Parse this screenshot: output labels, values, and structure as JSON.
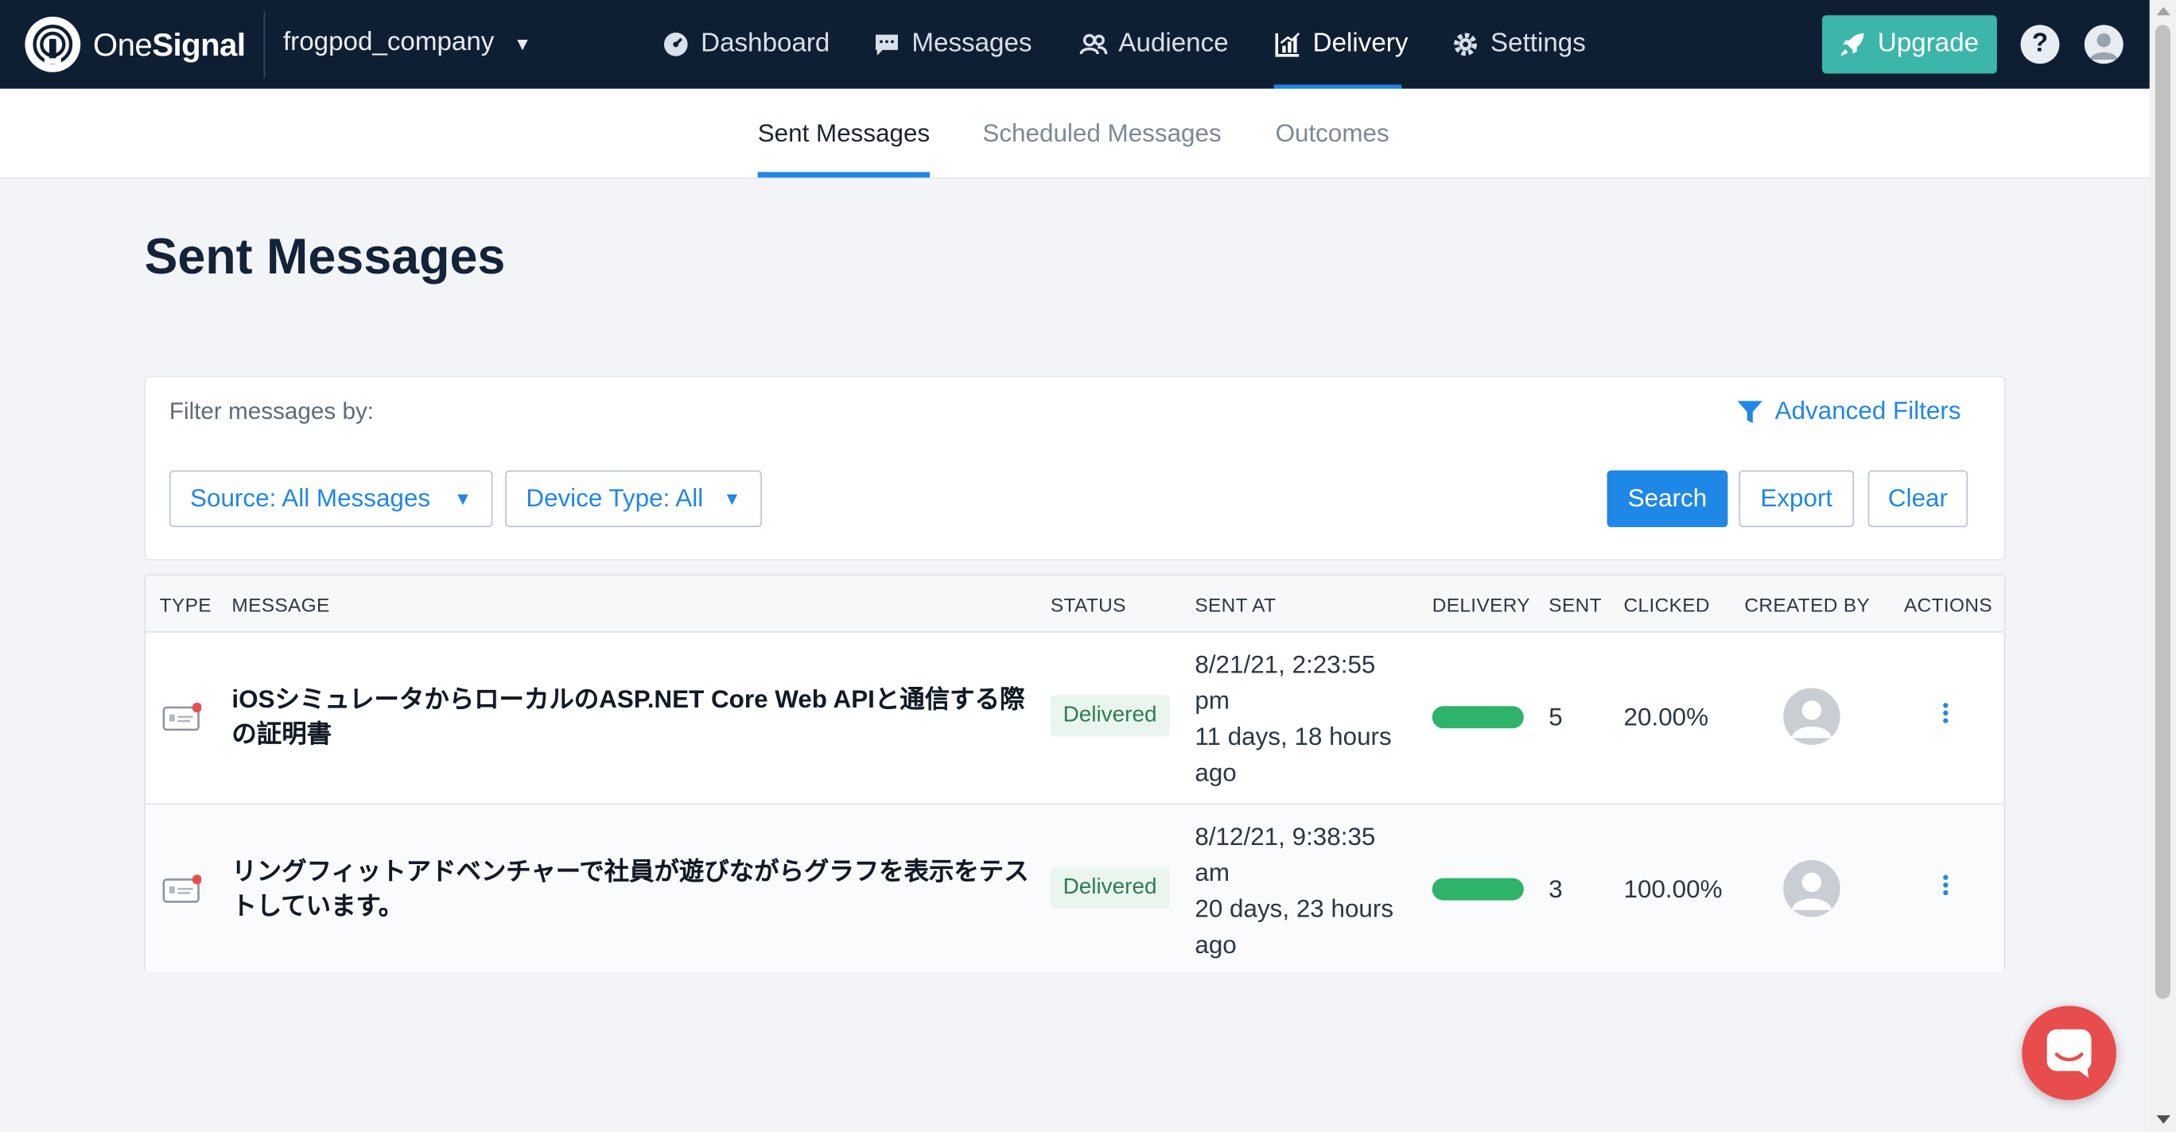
{
  "brand": {
    "name_prefix": "One",
    "name_suffix": "Signal"
  },
  "company": {
    "name": "frogpod_company"
  },
  "nav": {
    "items": [
      {
        "label": "Dashboard",
        "icon": "dashboard-icon"
      },
      {
        "label": "Messages",
        "icon": "messages-icon"
      },
      {
        "label": "Audience",
        "icon": "audience-icon"
      },
      {
        "label": "Delivery",
        "icon": "delivery-icon",
        "active": true
      },
      {
        "label": "Settings",
        "icon": "gear-icon"
      }
    ],
    "upgrade_label": "Upgrade",
    "help_label": "?"
  },
  "subtabs": {
    "items": [
      {
        "label": "Sent Messages",
        "active": true
      },
      {
        "label": "Scheduled Messages"
      },
      {
        "label": "Outcomes"
      }
    ]
  },
  "page": {
    "title": "Sent Messages"
  },
  "filters": {
    "label": "Filter messages by:",
    "advanced_label": "Advanced Filters",
    "source_label": "Source: All Messages",
    "device_label": "Device Type: All",
    "search_label": "Search",
    "export_label": "Export",
    "clear_label": "Clear"
  },
  "table": {
    "headers": [
      "TYPE",
      "MESSAGE",
      "STATUS",
      "SENT AT",
      "DELIVERY",
      "SENT",
      "CLICKED",
      "CREATED BY",
      "ACTIONS"
    ],
    "rows": [
      {
        "type_icon": "push-notification-icon",
        "message": "iOSシミュレータからローカルのASP.NET Core Web APIと通信する際の証明書",
        "status": "Delivered",
        "sent_at": "8/21/21, 2:23:55 pm",
        "sent_ago": "11 days, 18 hours ago",
        "delivery_fraction": 1.0,
        "sent": "5",
        "clicked": "20.00%"
      },
      {
        "type_icon": "push-notification-icon",
        "message": "リングフィットアドベンチャーで社員が遊びながらグラフを表示をテストしています。",
        "status": "Delivered",
        "sent_at": "8/12/21, 9:38:35 am",
        "sent_ago": "20 days, 23 hours ago",
        "delivery_fraction": 1.0,
        "sent": "3",
        "clicked": "100.00%"
      }
    ]
  },
  "colors": {
    "nav_bg": "#0f1f33",
    "accent": "#1f87e6",
    "upgrade": "#3bb6a9",
    "delivered_bar": "#2fb36b",
    "chat": "#e84d4d"
  }
}
